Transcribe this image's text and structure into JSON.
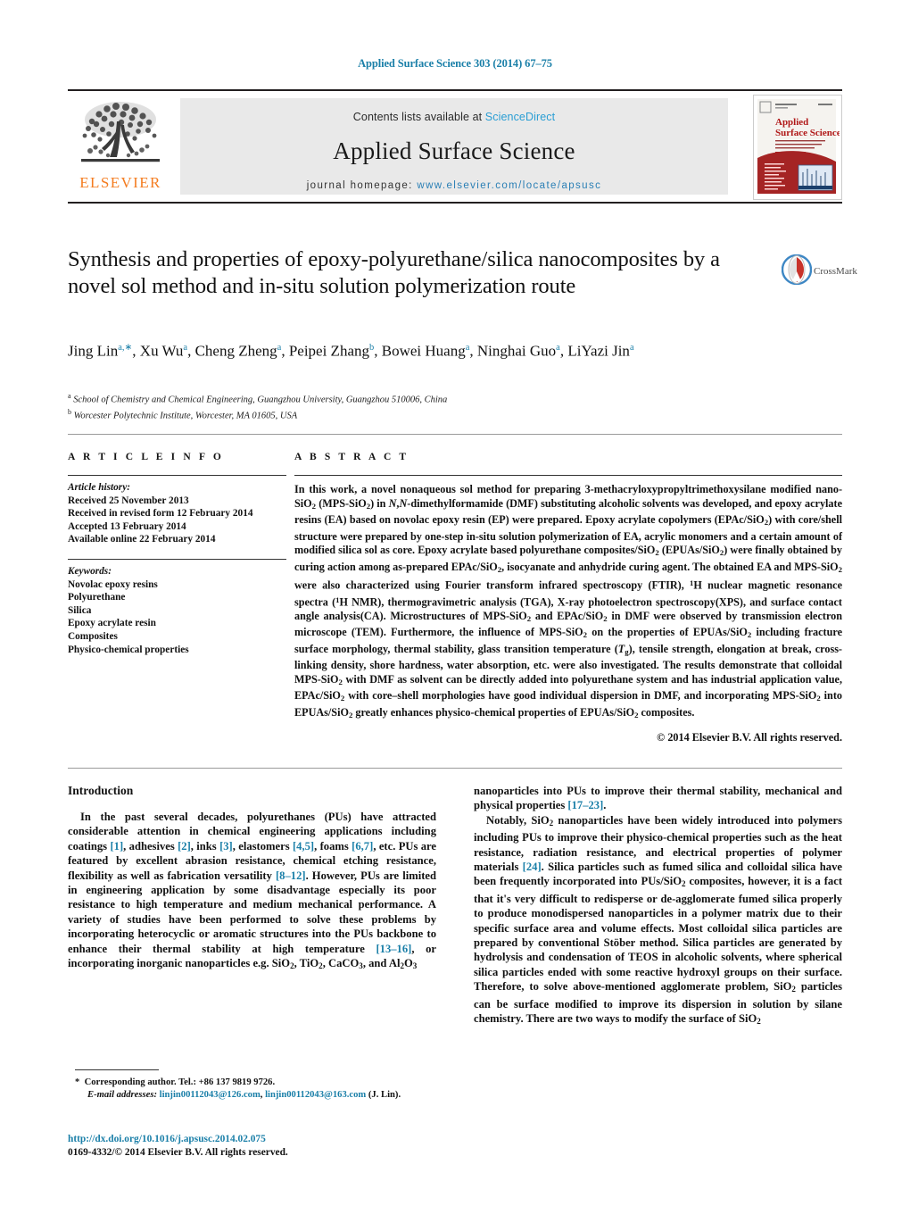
{
  "running_head": "Applied Surface Science 303 (2014) 67–75",
  "masthead": {
    "publisher_logo_text": "ELSEVIER",
    "contents_prefix": "Contents lists available at ",
    "contents_link": "ScienceDirect",
    "journal_title": "Applied Surface Science",
    "homepage_prefix": "journal homepage: ",
    "homepage_url": "www.elsevier.com/locate/apsusc",
    "cover_title_line1": "Applied",
    "cover_title_line2": "Surface Science"
  },
  "crossmark": {
    "label": "CrossMark"
  },
  "title": "Synthesis and properties of epoxy-polyurethane/silica nanocomposites by a novel sol method and in-situ solution polymerization route",
  "authors_html": "Jing Lin<sup>a,&lowast;</sup>, Xu Wu<sup>a</sup>, Cheng Zheng<sup>a</sup>, Peipei Zhang<sup>b</sup>, Bowei Huang<sup>a</sup>, Ninghai Guo<sup>a</sup>, LiYazi Jin<sup>a</sup>",
  "affiliations": [
    {
      "marker": "a",
      "text": "School of Chemistry and Chemical Engineering, Guangzhou University, Guangzhou 510006, China"
    },
    {
      "marker": "b",
      "text": "Worcester Polytechnic Institute, Worcester, MA 01605, USA"
    }
  ],
  "article_info": {
    "heading": "A R T I C L E    I N F O",
    "history_label": "Article history:",
    "history": [
      "Received 25 November 2013",
      "Received in revised form 12 February 2014",
      "Accepted 13 February 2014",
      "Available online 22 February 2014"
    ],
    "keywords_label": "Keywords:",
    "keywords": [
      "Novolac epoxy resins",
      "Polyurethane",
      "Silica",
      "Epoxy acrylate resin",
      "Composites",
      "Physico-chemical properties"
    ]
  },
  "abstract": {
    "heading": "A B S T R A C T",
    "body_html": "In this work, a novel nonaqueous sol method for preparing 3-methacryloxypropyltrimethoxysilane modified nano-SiO<sub>2</sub> (MPS-SiO<sub>2</sub>) in <i>N</i>,<i>N</i>-dimethylformamide (DMF) substituting alcoholic solvents was developed, and epoxy acrylate resins (EA) based on novolac epoxy resin (EP) were prepared. Epoxy acrylate copolymers (EPAc/SiO<sub>2</sub>) with core/shell structure were prepared by one-step in-situ solution polymerization of EA, acrylic monomers and a certain amount of modified silica sol as core. Epoxy acrylate based polyurethane composites/SiO<sub>2</sub> (EPUAs/SiO<sub>2</sub>) were finally obtained by curing action among as-prepared EPAc/SiO<sub>2</sub>, isocyanate and anhydride curing agent. The obtained EA and MPS-SiO<sub>2</sub> were also characterized using Fourier transform infrared spectroscopy (FTIR), <sup class=\"num\">1</sup>H nuclear magnetic resonance spectra (<sup class=\"num\">1</sup>H NMR), thermogravimetric analysis (TGA), X-ray photoelectron spectroscopy(XPS), and surface contact angle analysis(CA). Microstructures of MPS-SiO<sub>2</sub> and EPAc/SiO<sub>2</sub> in DMF were observed by transmission electron microscope (TEM). Furthermore, the influence of MPS-SiO<sub>2</sub> on the properties of EPUAs/SiO<sub>2</sub> including fracture surface morphology, thermal stability, glass transition temperature (<i>T</i><sub>g</sub>), tensile strength, elongation at break, cross-linking density, shore hardness, water absorption, etc. were also investigated. The results demonstrate that colloidal MPS-SiO<sub>2</sub> with DMF as solvent can be directly added into polyurethane system and has industrial application value, EPAc/SiO<sub>2</sub> with core–shell morphologies have good individual dispersion in DMF, and incorporating MPS-SiO<sub>2</sub> into EPUAs/SiO<sub>2</sub> greatly enhances physico-chemical properties of EPUAs/SiO<sub>2</sub> composites.",
    "copyright": "© 2014 Elsevier B.V. All rights reserved."
  },
  "introduction": {
    "heading": "Introduction",
    "left_paragraph_html": "In the past several decades, polyurethanes (PUs) have attracted considerable attention in chemical engineering applications including coatings <span class=\"ref\">[1]</span>, adhesives <span class=\"ref\">[2]</span>, inks <span class=\"ref\">[3]</span>, elastomers <span class=\"ref\">[4,5]</span>, foams <span class=\"ref\">[6,7]</span>, etc. PUs are featured by excellent abrasion resistance, chemical etching resistance, flexibility as well as fabrication versatility <span class=\"ref\">[8–12]</span>. However, PUs are limited in engineering application by some disadvantage especially its poor resistance to high temperature and medium mechanical performance. A variety of studies have been performed to solve these problems by incorporating heterocyclic or aromatic structures into the PUs backbone to enhance their thermal stability at high temperature <span class=\"ref\">[13–16]</span>, or incorporating inorganic nanoparticles e.g. SiO<sub>2</sub>, TiO<sub>2</sub>, CaCO<sub>3</sub>, and Al<sub>2</sub>O<sub>3</sub>",
    "right_paragraph1_html": "nanoparticles into PUs to improve their thermal stability, mechanical and physical properties <span class=\"ref\">[17–23]</span>.",
    "right_paragraph2_html": "Notably, SiO<sub>2</sub> nanoparticles have been widely introduced into polymers including PUs to improve their physico-chemical properties such as the heat resistance, radiation resistance, and electrical properties of polymer materials <span class=\"ref\">[24]</span>. Silica particles such as fumed silica and colloidal silica have been frequently incorporated into PUs/SiO<sub>2</sub> composites, however, it is a fact that it's very difficult to redisperse or de-agglomerate fumed silica properly to produce monodispersed nanoparticles in a polymer matrix due to their specific surface area and volume effects. Most colloidal silica particles are prepared by conventional Stöber method. Silica particles are generated by hydrolysis and condensation of TEOS in alcoholic solvents, where spherical silica particles ended with some reactive hydroxyl groups on their surface. Therefore, to solve above-mentioned agglomerate problem, SiO<sub>2</sub> particles can be surface modified to improve its dispersion in solution by silane chemistry. There are two ways to modify the surface of SiO<sub>2</sub>"
  },
  "footnotes": {
    "corresponding_html": "<b>*</b>&nbsp; Corresponding author. Tel.: +86 137 9819 9726.",
    "email_label": "E-mail addresses:",
    "email1": "linjin00112043@126.com",
    "email2": "linjin00112043@163.com",
    "email_suffix": "(J. Lin)."
  },
  "doi": {
    "url": "http://dx.doi.org/10.1016/j.apsusc.2014.02.075",
    "copyright": "0169-4332/© 2014 Elsevier B.V. All rights reserved."
  },
  "colors": {
    "link": "#1a7fa8",
    "elsevier_orange": "#f47c20",
    "band_gray": "#e9e9e9"
  }
}
